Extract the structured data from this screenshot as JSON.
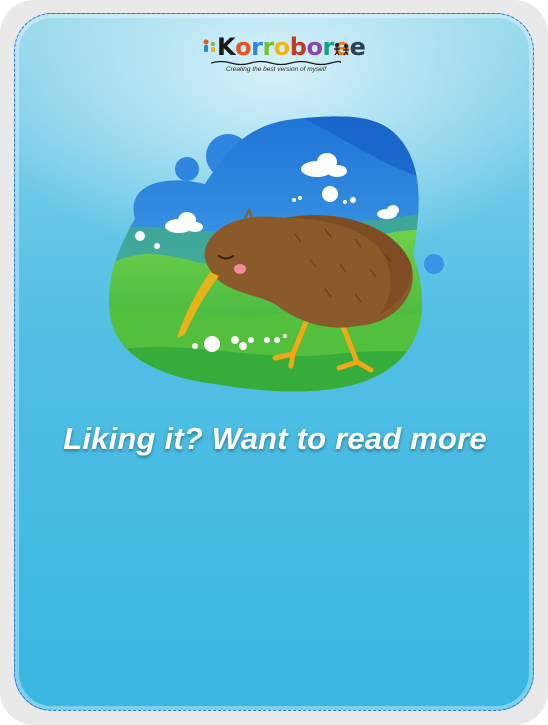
{
  "logo": {
    "brand_name": "Korroboree",
    "tagline": "Creating the best version of myself"
  },
  "headline": "Liking it? Want to read more",
  "colors": {
    "card_top": "#8fd5ec",
    "card_bottom": "#39b7e1",
    "card_border": "#3b6fd1",
    "headline_text": "#ffffff"
  },
  "illustration": {
    "icon": "kiwi-bird-icon"
  }
}
